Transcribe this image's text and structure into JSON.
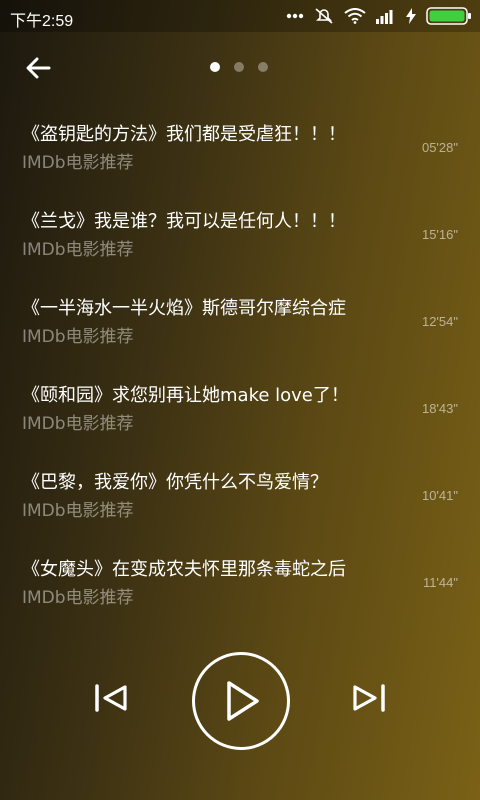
{
  "status_bar": {
    "time": "下午2:59",
    "icons": [
      "more-dots-icon",
      "muted-icon",
      "wifi-icon",
      "signal-icon",
      "charging-icon",
      "battery-icon"
    ]
  },
  "header": {
    "back_icon": "back-arrow-icon",
    "page_indicator": {
      "count": 3,
      "active": 0
    }
  },
  "tracks": [
    {
      "title": "《盗钥匙的方法》我们都是受虐狂！！！",
      "subtitle": "IMDb电影推荐",
      "duration": "05'28\""
    },
    {
      "title": "《兰戈》我是谁？我可以是任何人！！！",
      "subtitle": "IMDb电影推荐",
      "duration": "15'16\""
    },
    {
      "title": "《一半海水一半火焰》斯德哥尔摩综合症",
      "subtitle": "IMDb电影推荐",
      "duration": "12'54\""
    },
    {
      "title": "《颐和园》求您别再让她make love了！",
      "subtitle": "IMDb电影推荐",
      "duration": "18'43\""
    },
    {
      "title": "《巴黎，我爱你》你凭什么不鸟爱情？",
      "subtitle": "IMDb电影推荐",
      "duration": "10'41\""
    },
    {
      "title": "《女魔头》在变成农夫怀里那条毒蛇之后",
      "subtitle": "IMDb电影推荐",
      "duration": "11'44\""
    }
  ],
  "player": {
    "prev_icon": "skip-previous-icon",
    "play_icon": "play-icon",
    "next_icon": "skip-next-icon"
  },
  "colors": {
    "text": "#ffffff",
    "subtitle": "#ffffff73",
    "background_start": "#1c180e",
    "background_end": "#7a6116"
  }
}
